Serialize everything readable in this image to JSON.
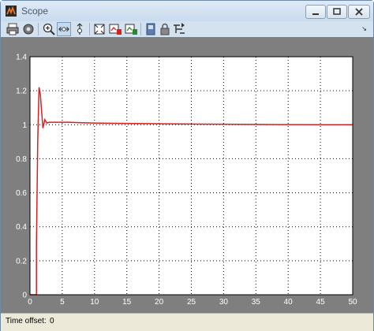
{
  "window": {
    "title": "Scope",
    "buttons": [
      "minimize",
      "restore",
      "close"
    ]
  },
  "toolbar": {
    "icons": [
      "print-icon",
      "parameters-icon",
      "zoom-in-icon",
      "zoom-x-icon",
      "zoom-y-icon",
      "autoscale-icon",
      "save-axes-icon",
      "restore-axes-icon",
      "floating-scope-icon",
      "lock-icon",
      "signal-selection-icon"
    ],
    "active": "zoom-x-icon"
  },
  "colors": {
    "plot_background": "#ffffff",
    "figure_background": "#7f7f7f",
    "grid": "#000000",
    "signal": "#d92020",
    "axis_text": "#ffffff"
  },
  "status": {
    "label": "Time offset:",
    "value": "0"
  },
  "chart_data": {
    "type": "line",
    "xlim": [
      0,
      50
    ],
    "ylim": [
      0,
      1.4
    ],
    "x_ticks": [
      "0",
      "5",
      "10",
      "15",
      "20",
      "25",
      "30",
      "35",
      "40",
      "45",
      "50"
    ],
    "y_ticks": [
      "0",
      "0.2",
      "0.4",
      "0.6",
      "0.8",
      "1",
      "1.2",
      "1.4"
    ],
    "grid": true,
    "series": [
      {
        "x": [
          0,
          1.0,
          1.0,
          1.2,
          1.4,
          1.6,
          1.8,
          2.0,
          2.3,
          2.6,
          3.0,
          4,
          6,
          8,
          10,
          15,
          20,
          25,
          30,
          35,
          40,
          45,
          50
        ],
        "y": [
          0,
          0,
          0.3,
          0.9,
          1.22,
          1.18,
          1.08,
          0.98,
          1.03,
          1.01,
          1.015,
          1.015,
          1.015,
          1.012,
          1.01,
          1.008,
          1.006,
          1.004,
          1.003,
          1.002,
          1.001,
          1.0,
          1.0
        ]
      }
    ]
  }
}
